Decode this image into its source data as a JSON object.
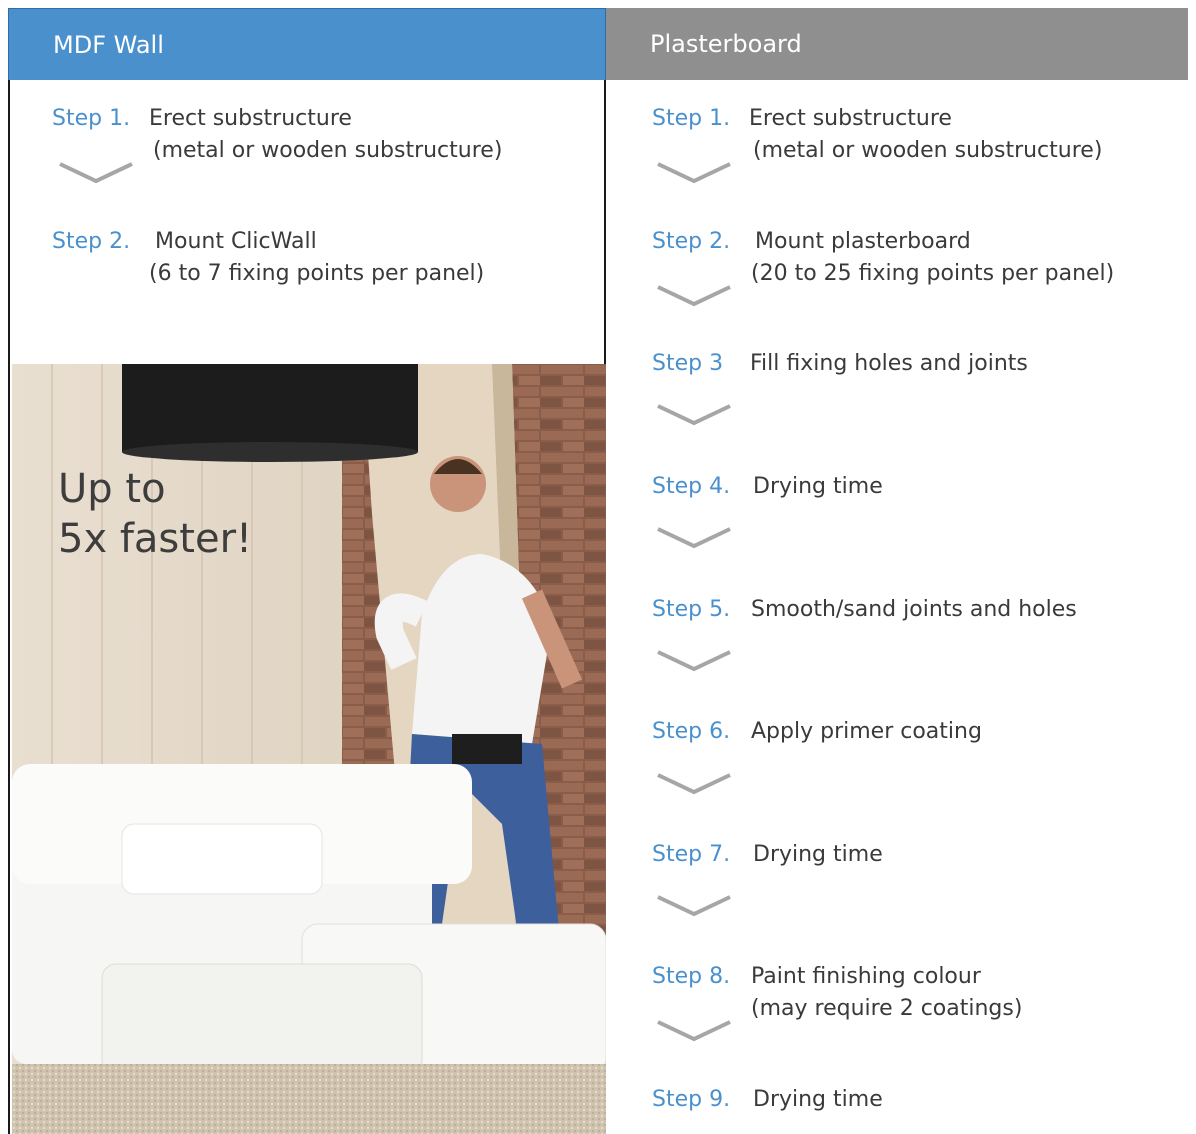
{
  "headers": {
    "left": "MDF Wall",
    "right": "Plasterboard"
  },
  "mdf_steps": [
    {
      "num": "Step 1.",
      "text": "Erect substructure",
      "sub": "(metal or wooden substructure)"
    },
    {
      "num": "Step 2.",
      "text": "Mount ClicWall",
      "sub": "(6 to 7 fixing points per panel)"
    }
  ],
  "slogan": {
    "line1": "Up to",
    "line2": "5x faster!"
  },
  "plaster_steps": [
    {
      "num": "Step 1.",
      "text": "Erect substructure",
      "sub": "(metal or wooden substructure)"
    },
    {
      "num": "Step 2.",
      "text": "Mount plasterboard",
      "sub": "(20 to 25 fixing points per panel)"
    },
    {
      "num": "Step 3",
      "text": "Fill fixing holes and joints",
      "sub": ""
    },
    {
      "num": "Step 4.",
      "text": "Drying time",
      "sub": ""
    },
    {
      "num": "Step 5.",
      "text": "Smooth/sand joints and holes",
      "sub": ""
    },
    {
      "num": "Step 6.",
      "text": "Apply primer coating",
      "sub": ""
    },
    {
      "num": "Step 7.",
      "text": "Drying time",
      "sub": ""
    },
    {
      "num": "Step 8.",
      "text": "Paint finishing colour",
      "sub": "(may require 2 coatings)"
    },
    {
      "num": "Step 9.",
      "text": "Drying time",
      "sub": ""
    }
  ],
  "icons": {
    "chevron": "chevron-down-icon"
  },
  "colors": {
    "accent_blue": "#4a90cd",
    "header_grey": "#8f8f8f",
    "chevron_grey": "#a6a6a6"
  }
}
